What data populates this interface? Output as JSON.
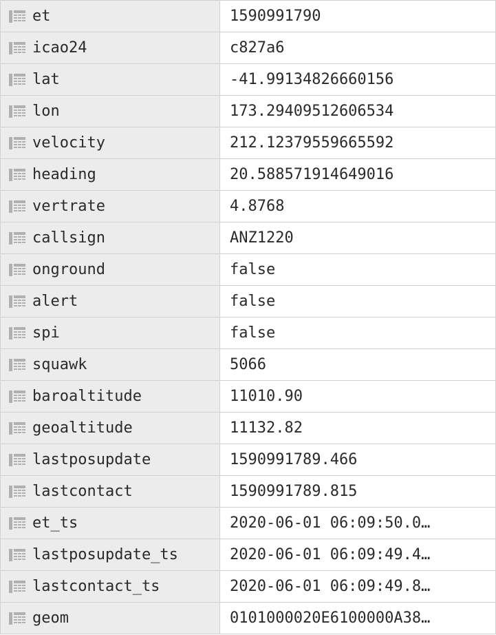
{
  "rows": [
    {
      "key": "et",
      "value": "1590991790"
    },
    {
      "key": "icao24",
      "value": "c827a6"
    },
    {
      "key": "lat",
      "value": "-41.99134826660156"
    },
    {
      "key": "lon",
      "value": "173.29409512606534"
    },
    {
      "key": "velocity",
      "value": "212.12379559665592"
    },
    {
      "key": "heading",
      "value": "20.588571914649016"
    },
    {
      "key": "vertrate",
      "value": "4.8768"
    },
    {
      "key": "callsign",
      "value": "ANZ1220"
    },
    {
      "key": "onground",
      "value": "false"
    },
    {
      "key": "alert",
      "value": "false"
    },
    {
      "key": "spi",
      "value": "false"
    },
    {
      "key": "squawk",
      "value": "5066"
    },
    {
      "key": "baroaltitude",
      "value": "11010.90"
    },
    {
      "key": "geoaltitude",
      "value": "11132.82"
    },
    {
      "key": "lastposupdate",
      "value": "1590991789.466"
    },
    {
      "key": "lastcontact",
      "value": "1590991789.815"
    },
    {
      "key": "et_ts",
      "value": "2020-06-01 06:09:50.0…"
    },
    {
      "key": "lastposupdate_ts",
      "value": "2020-06-01 06:09:49.4…"
    },
    {
      "key": "lastcontact_ts",
      "value": "2020-06-01 06:09:49.8…"
    },
    {
      "key": "geom",
      "value": "0101000020E6100000A38…"
    }
  ]
}
